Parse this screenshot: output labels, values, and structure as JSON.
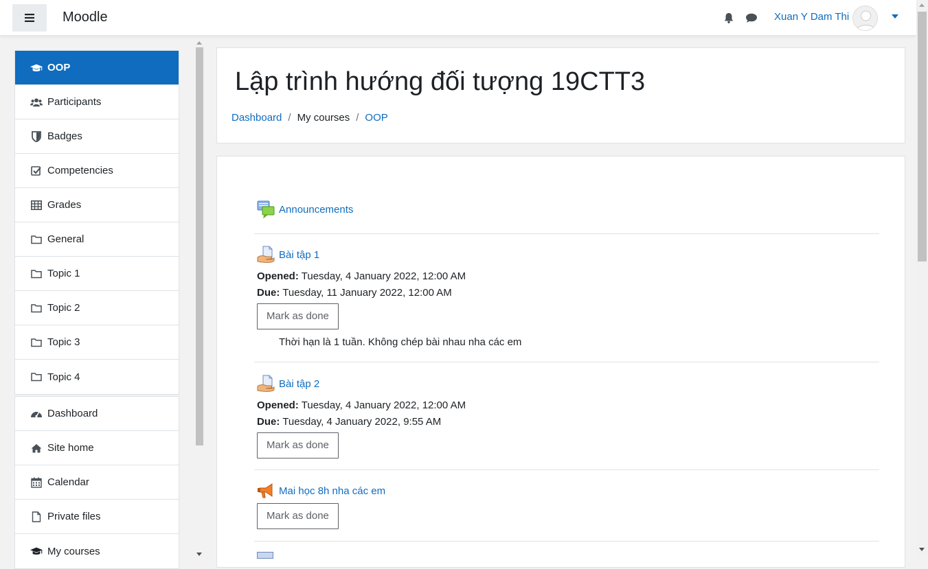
{
  "navbar": {
    "brand": "Moodle",
    "user_name": "Xuan Y Dam Thi",
    "notification_icon": "bell-icon",
    "messages_icon": "comment-icon"
  },
  "sidebar": {
    "course_items": [
      {
        "label": "OOP",
        "icon": "graduation-cap-icon",
        "active": true
      },
      {
        "label": "Participants",
        "icon": "users-icon"
      },
      {
        "label": "Badges",
        "icon": "shield-icon"
      },
      {
        "label": "Competencies",
        "icon": "check-square-icon"
      },
      {
        "label": "Grades",
        "icon": "table-icon"
      },
      {
        "label": "General",
        "icon": "folder-icon"
      },
      {
        "label": "Topic 1",
        "icon": "folder-icon"
      },
      {
        "label": "Topic 2",
        "icon": "folder-icon"
      },
      {
        "label": "Topic 3",
        "icon": "folder-icon"
      },
      {
        "label": "Topic 4",
        "icon": "folder-icon"
      }
    ],
    "site_items": [
      {
        "label": "Dashboard",
        "icon": "tachometer-icon"
      },
      {
        "label": "Site home",
        "icon": "home-icon"
      },
      {
        "label": "Calendar",
        "icon": "calendar-icon"
      },
      {
        "label": "Private files",
        "icon": "file-icon"
      },
      {
        "label": "My courses",
        "icon": "graduation-cap-icon"
      }
    ]
  },
  "header": {
    "title": "Lập trình hướng đối tượng 19CTT3",
    "breadcrumb": [
      "Dashboard",
      "My courses",
      "OOP"
    ]
  },
  "activities": [
    {
      "name": "Announcements",
      "icon": "forum-icon"
    },
    {
      "name": "Bài tập 1",
      "icon": "assignment-icon",
      "opened_label": "Opened:",
      "opened": "Tuesday, 4 January 2022, 12:00 AM",
      "due_label": "Due:",
      "due": "Tuesday, 11 January 2022, 12:00 AM",
      "button": "Mark as done",
      "description": "Thời hạn là 1 tuần. Không chép bài nhau nha các em"
    },
    {
      "name": "Bài tập 2",
      "icon": "assignment-icon",
      "opened_label": "Opened:",
      "opened": "Tuesday, 4 January 2022, 12:00 AM",
      "due_label": "Due:",
      "due": "Tuesday, 4 January 2022, 9:55 AM",
      "button": "Mark as done"
    },
    {
      "name": "Mai học 8h nha các em",
      "icon": "megaphone-icon",
      "button": "Mark as done"
    }
  ],
  "colors": {
    "primary": "#0f6cbf",
    "background": "#f2f2f2"
  }
}
